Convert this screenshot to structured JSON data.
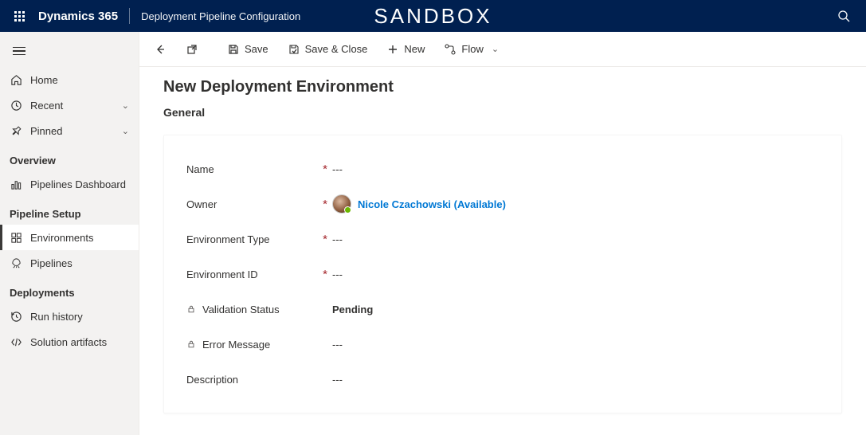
{
  "topbar": {
    "app_name": "Dynamics 365",
    "page_name": "Deployment Pipeline Configuration",
    "sandbox_label": "SANDBOX"
  },
  "sidebar": {
    "home": "Home",
    "recent": "Recent",
    "pinned": "Pinned",
    "group_overview": "Overview",
    "pipelines_dashboard": "Pipelines Dashboard",
    "group_setup": "Pipeline Setup",
    "environments": "Environments",
    "pipelines": "Pipelines",
    "group_deployments": "Deployments",
    "run_history": "Run history",
    "solution_artifacts": "Solution artifacts"
  },
  "cmdbar": {
    "save": "Save",
    "save_close": "Save & Close",
    "new": "New",
    "flow": "Flow"
  },
  "form": {
    "title": "New Deployment Environment",
    "tab": "General",
    "fields": {
      "name_label": "Name",
      "name_value": "---",
      "owner_label": "Owner",
      "owner_value": "Nicole Czachowski (Available)",
      "env_type_label": "Environment Type",
      "env_type_value": "---",
      "env_id_label": "Environment ID",
      "env_id_value": "---",
      "validation_label": "Validation Status",
      "validation_value": "Pending",
      "error_label": "Error Message",
      "error_value": "---",
      "description_label": "Description",
      "description_value": "---"
    }
  }
}
